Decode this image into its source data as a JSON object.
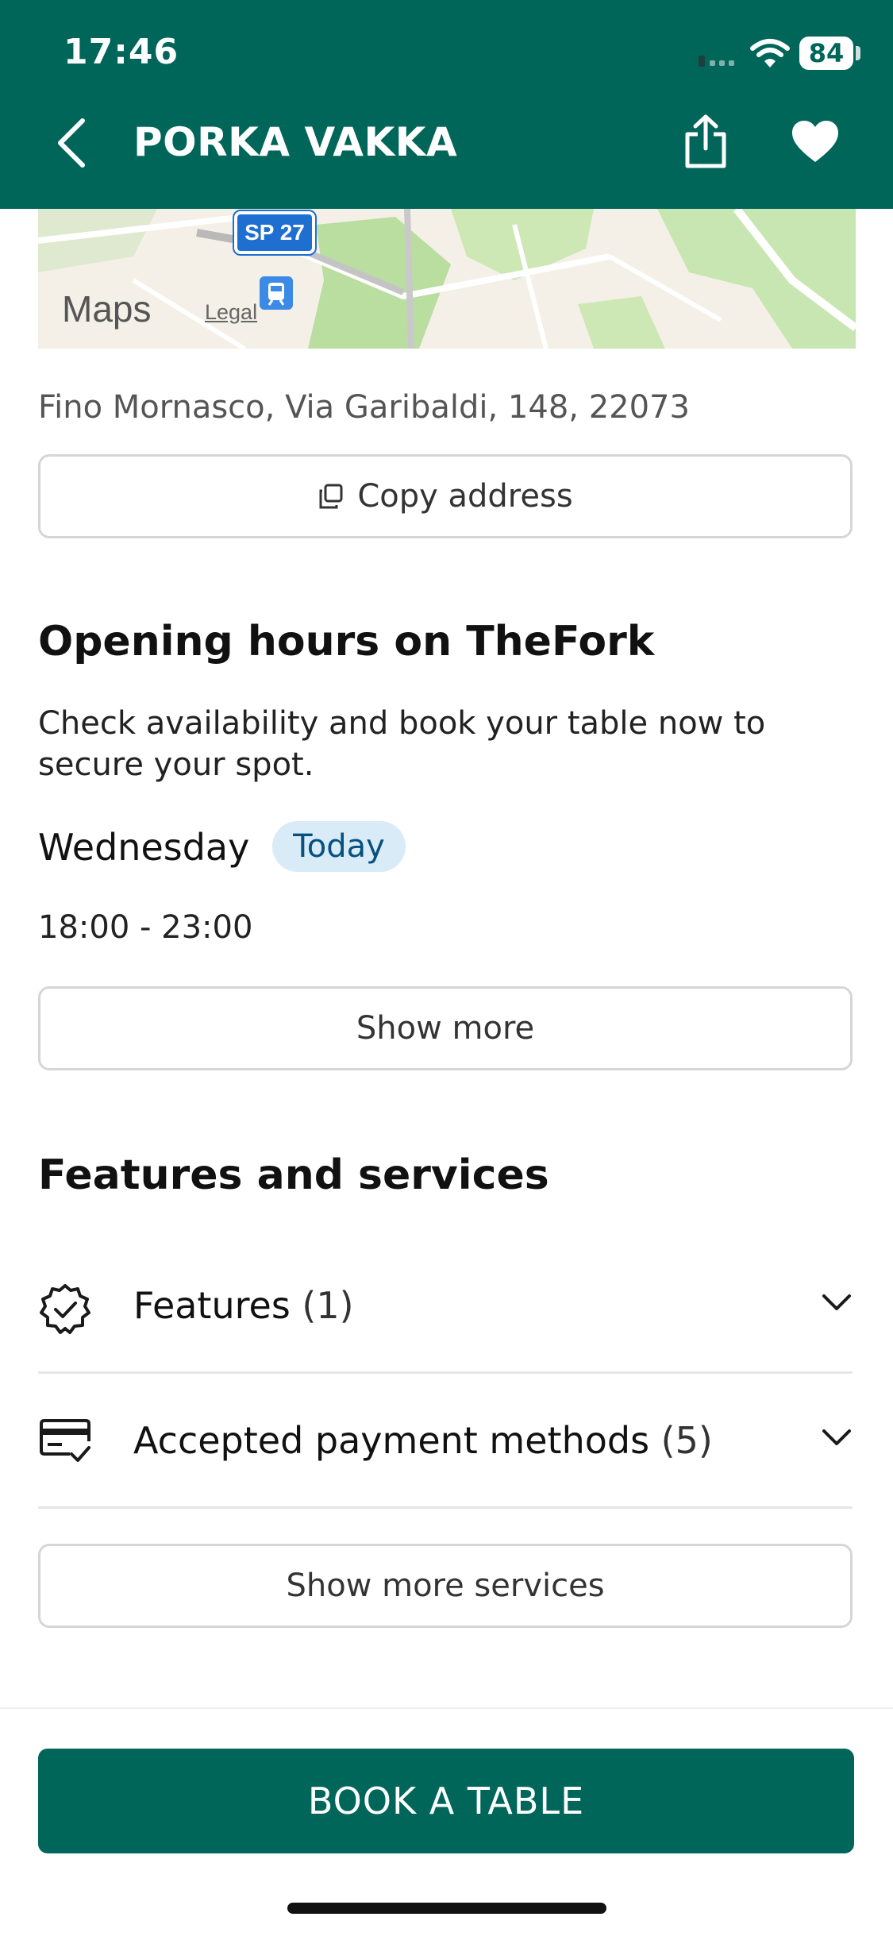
{
  "status_bar": {
    "time": "17:46",
    "battery": "84"
  },
  "header": {
    "title": "PORKA VAKKA"
  },
  "map": {
    "logo_text": "Maps",
    "legal": "Legal",
    "road_badge": "SP 27"
  },
  "address": {
    "text": "Fino Mornasco, Via Garibaldi, 148, 22073",
    "copy_label": "Copy address"
  },
  "hours": {
    "title": "Opening hours on TheFork",
    "description": "Check availability and book your table now to secure your spot.",
    "day": "Wednesday",
    "today_badge": "Today",
    "time_range": "18:00 - 23:00",
    "show_more": "Show more"
  },
  "features": {
    "title": "Features and services",
    "items": [
      {
        "label": "Features",
        "count": "(1)"
      },
      {
        "label": "Accepted payment methods",
        "count": "(5)"
      }
    ],
    "show_more_services": "Show more services"
  },
  "cta": {
    "book_label": "BOOK A TABLE"
  },
  "colors": {
    "brand": "#00665a",
    "badge_bg": "#d8ebf6",
    "badge_text": "#07507f"
  }
}
